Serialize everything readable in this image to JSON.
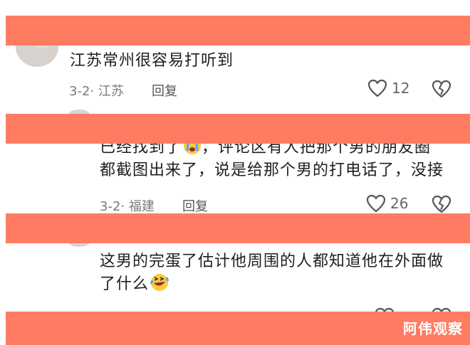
{
  "comments": [
    {
      "text": "江苏常州很容易打听到",
      "date": "3-2",
      "location": "江苏",
      "reply_label": "回复",
      "likes": "12"
    },
    {
      "text_line1": "已经找到了",
      "text_line1_rest": "，评论区有人把那个男的朋友圈",
      "text_line2": "都截图出来了，说是给那个男的打电话了，没接",
      "date": "3-2",
      "location": "福建",
      "reply_label": "回复",
      "likes": "26"
    },
    {
      "text_line1": "这男的完蛋了估计他周围的人都知道他在外面做",
      "text_line2": "了什么",
      "date": "",
      "location": "",
      "reply_label": "",
      "likes": ""
    }
  ],
  "separator": "·",
  "watermark": "阿伟观察",
  "colors": {
    "band": "#FF7B62",
    "text": "#1f1f1f",
    "meta": "#7a7a7a",
    "watermark": "#ffffff"
  },
  "icons": [
    "heart-outline-icon",
    "broken-heart-icon",
    "crying-emoji",
    "laughing-tears-emoji"
  ]
}
